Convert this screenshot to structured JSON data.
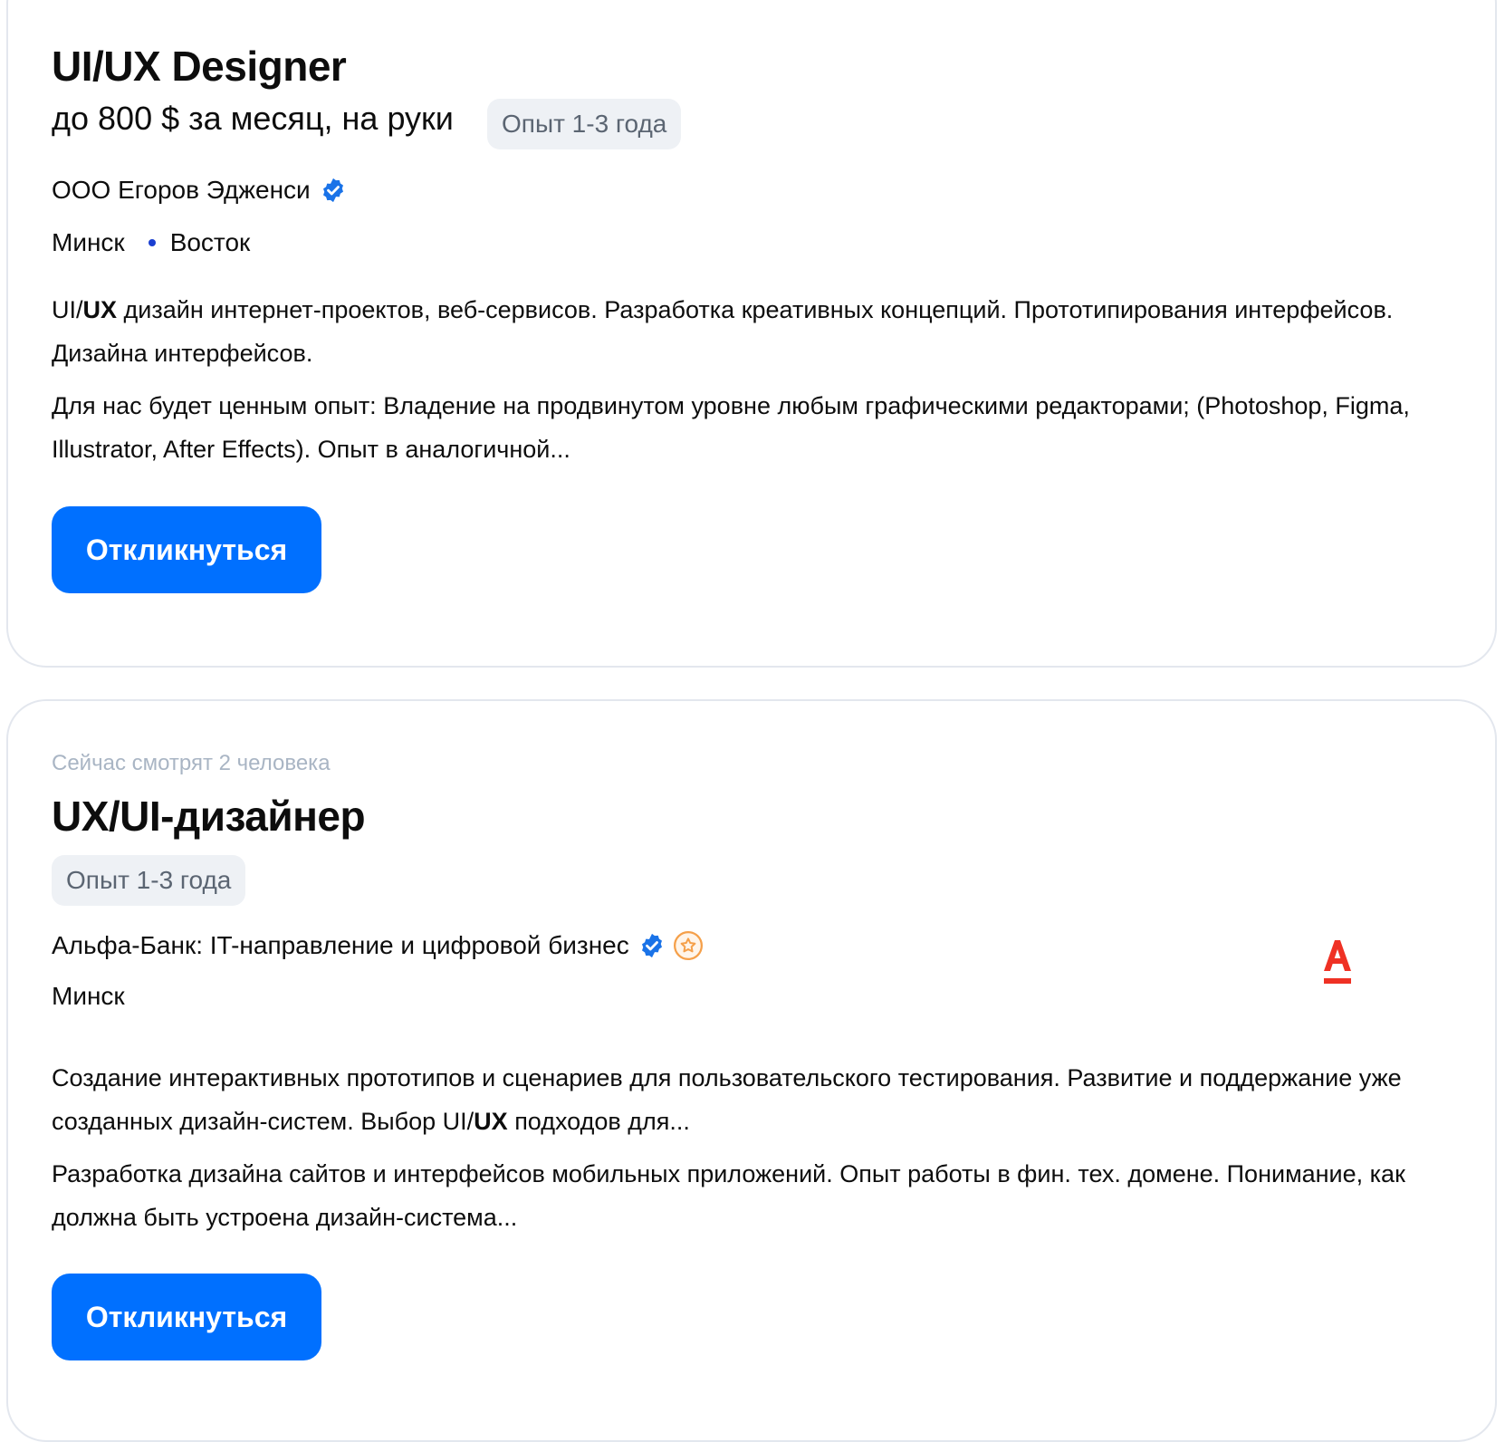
{
  "vacancies": [
    {
      "title": "UI/UX Designer",
      "salary": "до 800 $ за месяц, на руки",
      "experience": "Опыт 1-3 года",
      "company": "ООО Егоров Эдженси",
      "city": "Минск",
      "metro": "Восток",
      "desc1_pre": "UI/",
      "desc1_bold": "UX",
      "desc1_post": " дизайн интернет-проектов, веб-сервисов. Разработка креативных концепций. Прототипирования интерфейсов. Дизайна интерфейсов.",
      "desc2": "Для нас будет ценным опыт: Владение на продвинутом уровне любым графическими редакторами; (Photoshop, Figma, Illustrator, After Effects). Опыт в аналогичной...",
      "apply_label": "Откликнуться"
    },
    {
      "viewers": "Сейчас смотрят 2 человека",
      "title": "UX/UI-дизайнер",
      "experience": "Опыт 1-3 года",
      "company": "Альфа-Банк: IT-направление и цифровой бизнес",
      "city": "Минск",
      "desc1_pre": "Создание интерактивных прототипов и сценариев для пользовательского тестирования. Развитие и поддержание уже созданных дизайн-систем. Выбор UI/",
      "desc1_bold": "UX",
      "desc1_post": " подходов для...",
      "desc2": "Разработка дизайна сайтов и интерфейсов мобильных приложений. Опыт работы в фин. тех. домене. Понимание, как должна быть устроена дизайн-система...",
      "apply_label": "Откликнуться",
      "logo_letter": "А",
      "logo_color": "#ef3124"
    }
  ],
  "colors": {
    "accent": "#0070ff",
    "verified": "#1a73e8",
    "rating_badge": "#f5a04a"
  }
}
